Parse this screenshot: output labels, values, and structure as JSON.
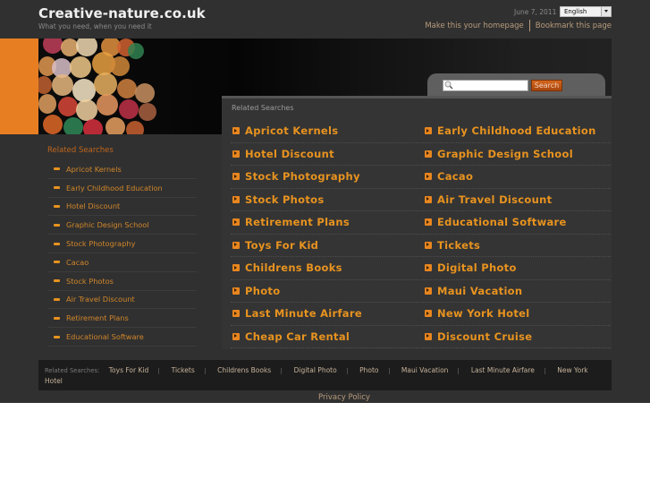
{
  "header": {
    "site_title": "Creative-nature.co.uk",
    "tagline": "What you need, when you need it",
    "date": "June 7, 2011",
    "language_selected": "English",
    "make_homepage": "Make this your homepage",
    "bookmark": "Bookmark this page"
  },
  "search": {
    "placeholder": "",
    "value": "",
    "button_label": "Search"
  },
  "main": {
    "heading": "Related Searches",
    "left_column": [
      "Apricot Kernels",
      "Hotel Discount",
      "Stock Photography",
      "Stock Photos",
      "Retirement Plans",
      "Toys For Kid",
      "Childrens Books",
      "Photo",
      "Last Minute Airfare",
      "Cheap Car Rental"
    ],
    "right_column": [
      "Early Childhood Education",
      "Graphic Design School",
      "Cacao",
      "Air Travel Discount",
      "Educational Software",
      "Tickets",
      "Digital Photo",
      "Maui Vacation",
      "New York Hotel",
      "Discount Cruise"
    ]
  },
  "sidebar": {
    "heading": "Related Searches",
    "items": [
      "Apricot Kernels",
      "Early Childhood Education",
      "Hotel Discount",
      "Graphic Design School",
      "Stock Photography",
      "Cacao",
      "Stock Photos",
      "Air Travel Discount",
      "Retirement Plans",
      "Educational Software"
    ]
  },
  "footer": {
    "label": "Related Searches:",
    "links": [
      "Toys For Kid",
      "Tickets",
      "Childrens Books",
      "Digital Photo",
      "Photo",
      "Maui Vacation",
      "Last Minute Airfare",
      "New York Hotel"
    ],
    "privacy": "Privacy Policy"
  },
  "colors": {
    "accent_orange": "#e87e22",
    "link_orange": "#e8931f",
    "background": "#303030"
  }
}
